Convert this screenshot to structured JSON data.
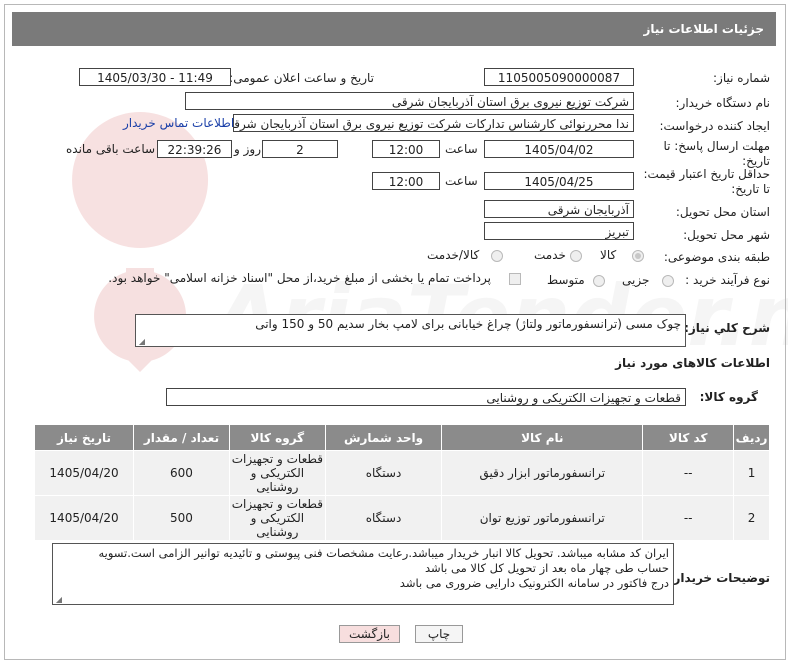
{
  "header": {
    "title": "جزئیات اطلاعات نیاز"
  },
  "form": {
    "need_number": {
      "label": "شماره نیاز:",
      "value": "1105005090000087"
    },
    "announce_datetime": {
      "label": "تاریخ و ساعت اعلان عمومی:",
      "value": "1405/03/30 - 11:49"
    },
    "buyer_org": {
      "label": "نام دستگاه خریدار:",
      "value": "شرکت توزیع نیروی برق استان آذربایجان شرقی"
    },
    "creator": {
      "label": "ایجاد کننده درخواست:",
      "value": "ندا محررنوائی کارشناس تدارکات شرکت توزیع نیروی برق استان آذربایجان شرقی",
      "contact_link": "اطلاعات تماس خریدار"
    },
    "reply_deadline": {
      "label_line1": "مهلت ارسال پاسخ: تا",
      "label_line2": "تاریخ:",
      "date": "1405/04/02",
      "time_label": "ساعت",
      "time": "12:00",
      "days": "2",
      "days_label": "روز و",
      "remaining": "22:39:26",
      "remaining_label": "ساعت باقی مانده"
    },
    "price_validity": {
      "label_line1": "حداقل تاریخ اعتبار قیمت:",
      "label_line2": "تا تاریخ:",
      "date": "1405/04/25",
      "time_label": "ساعت",
      "time": "12:00"
    },
    "delivery_province": {
      "label": "استان محل تحویل:",
      "value": "آذربایجان شرقی"
    },
    "delivery_city": {
      "label": "شهر محل تحویل:",
      "value": "تبریز"
    },
    "category": {
      "label": "طبقه بندی موضوعی:",
      "options": [
        "کالا",
        "خدمت",
        "کالا/خدمت"
      ],
      "selected": "کالا"
    },
    "purchase_type": {
      "label": "نوع فرآیند خرید :",
      "options": [
        "جزیی",
        "متوسط"
      ],
      "payment_note": "پرداخت تمام یا بخشی از مبلغ خرید،از محل \"اسناد خزانه اسلامی\" خواهد بود."
    }
  },
  "description": {
    "label": "شرح کلي نياز:",
    "value": "چوک مسی (ترانسفورماتور ولتاژ) چراغ خیابانی برای لامپ بخار سدیم 50 و 150 واتی"
  },
  "goods": {
    "section_title": "اطلاعات کالاهای مورد نیاز",
    "group_label": "گروه کالا:",
    "group_value": "قطعات و تجهیزات الکتریکی و روشنایی",
    "columns": [
      "ردیف",
      "کد کالا",
      "نام کالا",
      "واحد شمارش",
      "گروه کالا",
      "تعداد / مقدار",
      "تاریخ نیاز"
    ],
    "rows": [
      {
        "row": "1",
        "code": "--",
        "name": "ترانسفورماتور ابزار دقیق",
        "unit": "دستگاه",
        "group": "قطعات و تجهیزات الکتریکی و روشنایی",
        "qty": "600",
        "date": "1405/04/20"
      },
      {
        "row": "2",
        "code": "--",
        "name": "ترانسفورماتور توزیع توان",
        "unit": "دستگاه",
        "group": "قطعات و تجهیزات الکتریکی و روشنایی",
        "qty": "500",
        "date": "1405/04/20"
      }
    ]
  },
  "buyer_notes": {
    "label": "توضیحات خریدار:",
    "lines": [
      "ایران کد مشابه میباشد. تحویل کالا انبار خریدار میباشد.رعایت مشخصات فنی پیوستی و تائیدیه توانیر الزامی است.تسویه",
      "حساب طی چهار ماه بعد از تحویل کل کالا می باشد",
      "درج فاکتور در سامانه الکترونیک دارایی ضروری می باشد"
    ]
  },
  "buttons": {
    "print": "چاپ",
    "back": "بازگشت"
  },
  "watermark": {
    "text": "AriaTender.net"
  }
}
